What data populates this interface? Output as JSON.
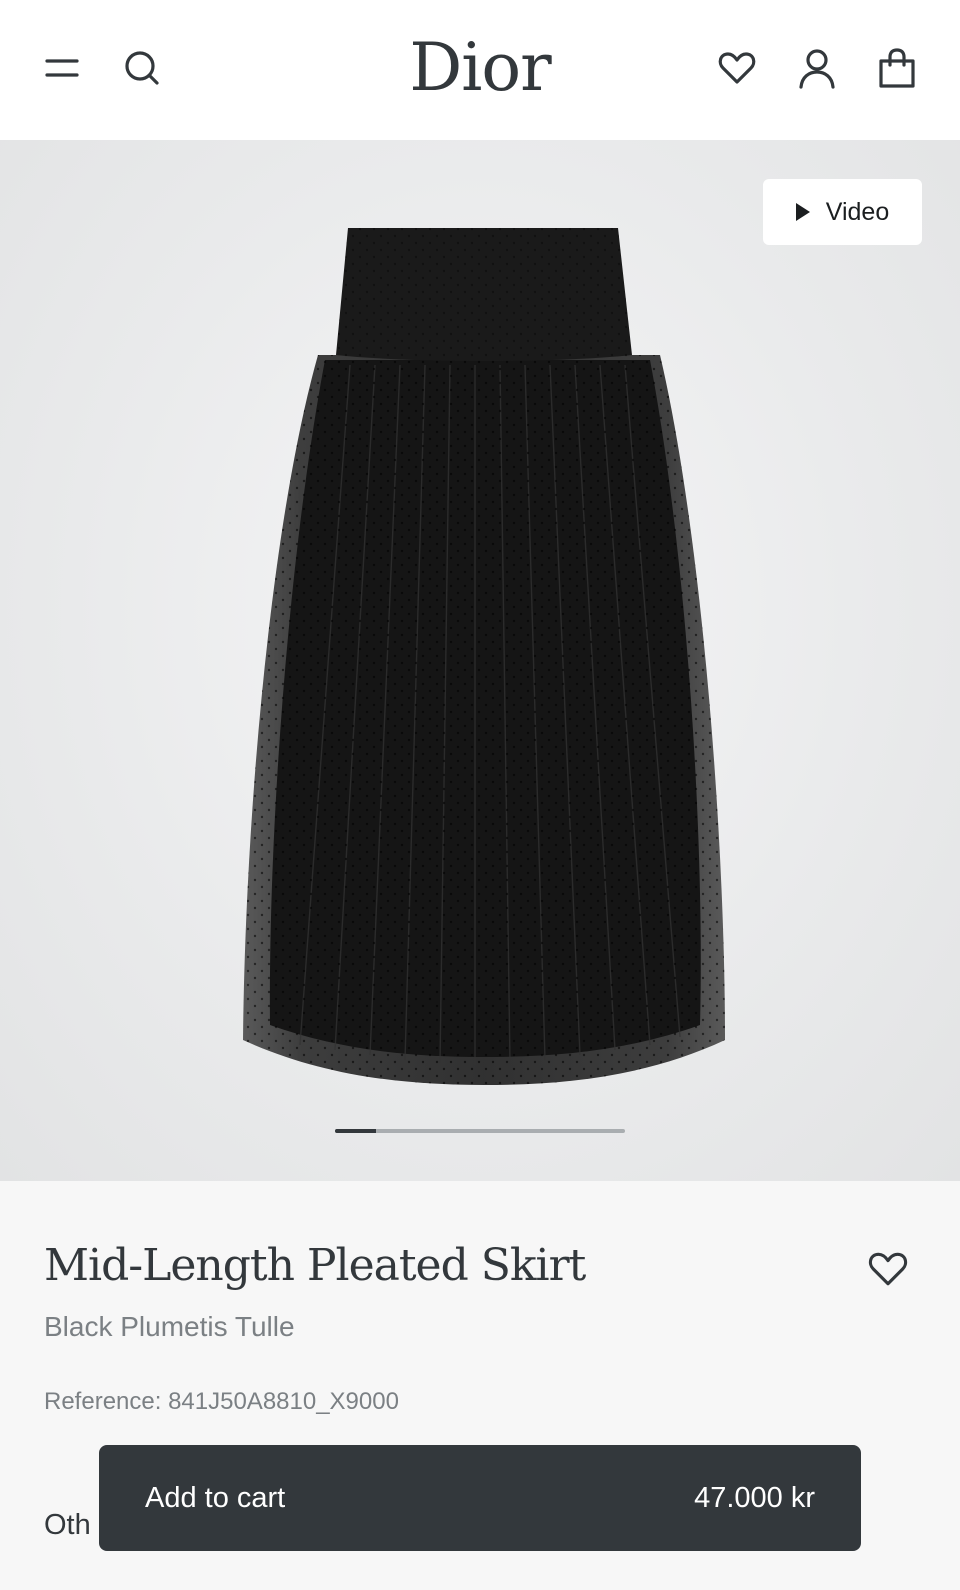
{
  "header": {
    "logo": "Dior",
    "icons": [
      "menu-icon",
      "search-icon",
      "heart-icon",
      "account-icon",
      "bag-icon"
    ]
  },
  "hero": {
    "video_label": "Video",
    "gallery_progress": 0.14
  },
  "product": {
    "title": "Mid-Length Pleated Skirt",
    "subtitle": "Black Plumetis Tulle",
    "reference": "Reference: 841J50A8810_X9000",
    "other_label_partial": "Oth"
  },
  "cart": {
    "label": "Add to cart",
    "price": "47.000 kr"
  },
  "colors": {
    "text": "#33383c",
    "muted": "#7b8084",
    "button": "#33383c",
    "background": "#f7f7f7"
  }
}
